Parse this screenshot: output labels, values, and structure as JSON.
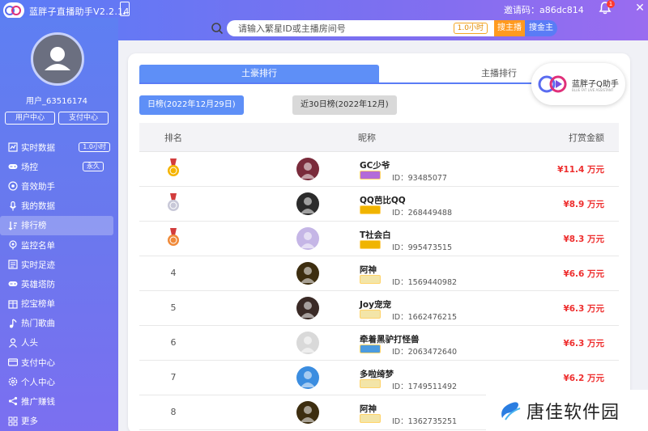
{
  "app": {
    "title": "蓝胖子直播助手V2.2.14"
  },
  "header": {
    "invite_text": "邀请码：a86dc814",
    "notification_count": "1",
    "close": "✕"
  },
  "search": {
    "placeholder": "请输入繁星ID或主播房间号",
    "tag": "1.0小时",
    "anchor_button": "搜主播",
    "gold_button": "搜金主"
  },
  "user": {
    "name": "用户_63516174",
    "center_button": "用户中心",
    "pay_button": "支付中心"
  },
  "sidebar": {
    "items": [
      {
        "label": "实时数据",
        "tag": "1.0小时",
        "icon": "chart-icon"
      },
      {
        "label": "场控",
        "tag": "永久",
        "icon": "gamepad-icon"
      },
      {
        "label": "音效助手",
        "tag": "",
        "icon": "sound-icon"
      },
      {
        "label": "我的数据",
        "tag": "",
        "icon": "mic-icon"
      },
      {
        "label": "排行榜",
        "tag": "",
        "icon": "sort-icon",
        "active": true
      },
      {
        "label": "监控名单",
        "tag": "",
        "icon": "monitor-icon"
      },
      {
        "label": "实时足迹",
        "tag": "",
        "icon": "footprint-icon"
      },
      {
        "label": "英雄塔防",
        "tag": "",
        "icon": "gamepad-icon"
      },
      {
        "label": "挖宝榜单",
        "tag": "",
        "icon": "list-icon"
      },
      {
        "label": "热门歌曲",
        "tag": "",
        "icon": "music-icon"
      },
      {
        "label": "人头",
        "tag": "",
        "icon": "person-icon"
      },
      {
        "label": "支付中心",
        "tag": "",
        "icon": "pay-icon"
      },
      {
        "label": "个人中心",
        "tag": "",
        "icon": "gear-icon"
      },
      {
        "label": "推广赚钱",
        "tag": "",
        "icon": "share-icon"
      },
      {
        "label": "更多",
        "tag": "",
        "icon": "grid-icon"
      }
    ]
  },
  "ranking": {
    "tabs": [
      "土豪排行",
      "主播排行"
    ],
    "brand": {
      "name": "蓝胖子Q助手",
      "sub": "BLUE FAT LIVE ASSISTANT"
    },
    "sub_tabs": [
      "日榜(2022年12月29日)",
      "近30日榜(2022年12月)"
    ],
    "columns": [
      "排名",
      "昵称",
      "打赏金额"
    ],
    "rows": [
      {
        "rank": "1",
        "medal": "gold",
        "nickname": "GC少爷",
        "uid": "ID：93485077",
        "amount": "¥11.4 万元",
        "avatar_color": "#7a2b3b",
        "level_color": "#b36bd9"
      },
      {
        "rank": "2",
        "medal": "silver",
        "nickname": "QQ芭比QQ",
        "uid": "ID：268449488",
        "amount": "¥8.9 万元",
        "avatar_color": "#2b2b2b",
        "level_color": "#f0b400"
      },
      {
        "rank": "3",
        "medal": "bronze",
        "nickname": "T社会白",
        "uid": "ID：995473515",
        "amount": "¥8.3 万元",
        "avatar_color": "#c5b6e6",
        "level_color": "#f0b400"
      },
      {
        "rank": "4",
        "medal": "",
        "nickname": "阿神",
        "uid": "ID：1569440982",
        "amount": "¥6.6 万元",
        "avatar_color": "#3d2e10",
        "level_color": "#f3e5a8"
      },
      {
        "rank": "5",
        "medal": "",
        "nickname": "Joy宠宠",
        "uid": "ID：1662476215",
        "amount": "¥6.3 万元",
        "avatar_color": "#3a2a26",
        "level_color": "#f3e5a8"
      },
      {
        "rank": "6",
        "medal": "",
        "nickname": "牵着黑驴打怪兽",
        "uid": "ID：2063472640",
        "amount": "¥6.3 万元",
        "avatar_color": "#d9d9d9",
        "level_color": "#4b9be0"
      },
      {
        "rank": "7",
        "medal": "",
        "nickname": "多啦绮梦",
        "uid": "ID：1749511492",
        "amount": "¥6.2 万元",
        "avatar_color": "#3b8de0",
        "level_color": "#f3e5a8"
      },
      {
        "rank": "8",
        "medal": "",
        "nickname": "阿神",
        "uid": "ID：1362735251",
        "amount": "¥6.1 万元",
        "avatar_color": "#3d2e10",
        "level_color": "#f3e5a8"
      }
    ]
  },
  "watermark": {
    "text": "唐佳软件园"
  }
}
